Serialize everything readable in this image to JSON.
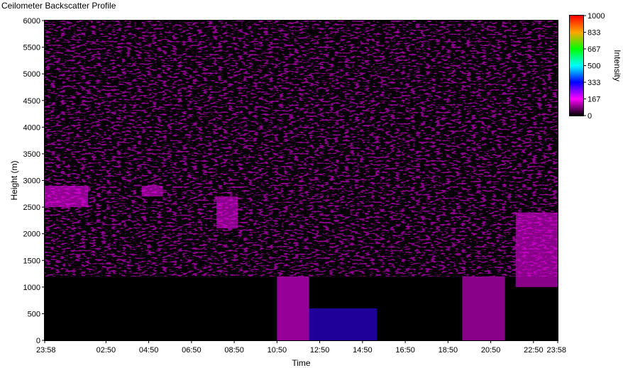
{
  "window": {
    "title": "Ceilometer Backscatter Profile"
  },
  "chart_data": {
    "type": "heatmap",
    "title": "Ceilometer Backscatter Profile",
    "xlabel": "Time",
    "ylabel": "Height (m)",
    "x_ticks": [
      "23:58",
      "02:50",
      "04:50",
      "06:50",
      "08:50",
      "10:50",
      "12:50",
      "14:50",
      "16:50",
      "18:50",
      "20:50",
      "22:50",
      "23:58"
    ],
    "y_ticks": [
      0,
      500,
      1000,
      1500,
      2000,
      2500,
      3000,
      3500,
      4000,
      4500,
      5000,
      5500,
      6000
    ],
    "ylim": [
      0,
      6000
    ],
    "colorbar": {
      "label": "Intensity",
      "range": [
        0,
        1000
      ],
      "ticks": [
        0,
        167,
        333,
        500,
        667,
        833,
        1000
      ],
      "stops": [
        {
          "value": 0,
          "color": "#000000"
        },
        {
          "value": 167,
          "color": "#ff00ff"
        },
        {
          "value": 333,
          "color": "#0000ff"
        },
        {
          "value": 500,
          "color": "#00ffff"
        },
        {
          "value": 667,
          "color": "#00ff00"
        },
        {
          "value": 833,
          "color": "#ffa500"
        },
        {
          "value": 1000,
          "color": "#ff0000"
        }
      ]
    },
    "features": [
      {
        "kind": "cloud-layer",
        "time_range": [
          "23:58",
          "02:00"
        ],
        "height_range": [
          2500,
          2900
        ],
        "intensity": 160
      },
      {
        "kind": "cloud-layer",
        "time_range": [
          "04:30",
          "05:30"
        ],
        "height_range": [
          2700,
          2900
        ],
        "intensity": 150
      },
      {
        "kind": "cloud-layer",
        "time_range": [
          "08:00",
          "09:00"
        ],
        "height_range": [
          2100,
          2700
        ],
        "intensity": 150
      },
      {
        "kind": "boundary-layer",
        "time_range": [
          "10:50",
          "12:20"
        ],
        "height_range": [
          0,
          1200
        ],
        "intensity": 170
      },
      {
        "kind": "boundary-layer",
        "time_range": [
          "12:20",
          "15:30"
        ],
        "height_range": [
          0,
          600
        ],
        "intensity": 300
      },
      {
        "kind": "boundary-layer",
        "time_range": [
          "19:30",
          "21:30"
        ],
        "height_range": [
          0,
          1200
        ],
        "intensity": 150
      },
      {
        "kind": "cloud-layer",
        "time_range": [
          "22:00",
          "23:58"
        ],
        "height_range": [
          1000,
          2400
        ],
        "intensity": 150
      }
    ]
  }
}
